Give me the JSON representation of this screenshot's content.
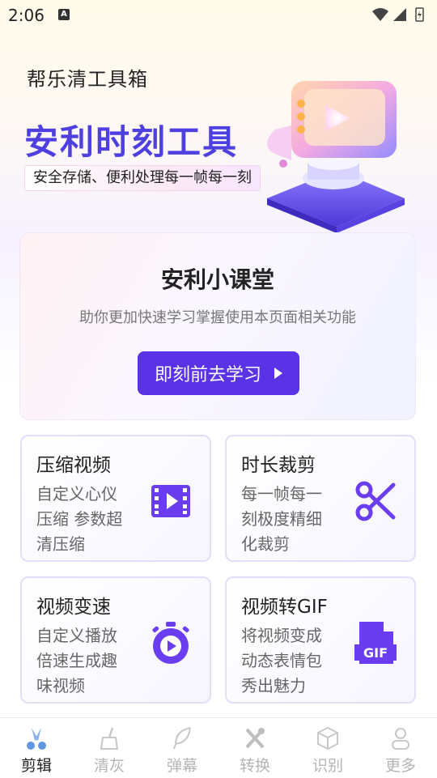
{
  "status": {
    "time": "2:06",
    "a_icon": "A"
  },
  "hero": {
    "subtitle": "帮乐清工具箱",
    "title": "安利时刻工具",
    "tagline": "安全存储、便利处理每一帧每一刻",
    "art_icon": "video-player-illustration-icon"
  },
  "lesson": {
    "title": "安利小课堂",
    "description": "助你更加快速学习掌握使用本页面相关功能",
    "button_label": "即刻前去学习"
  },
  "cards": [
    {
      "title": "压缩视频",
      "desc": "自定义心仪压缩 参数超清压缩",
      "icon": "video-film-icon"
    },
    {
      "title": "时长裁剪",
      "desc": "每一帧每一刻极度精细化裁剪",
      "icon": "scissors-icon"
    },
    {
      "title": "视频变速",
      "desc": "自定义播放倍速生成趣味视频",
      "icon": "stopwatch-icon"
    },
    {
      "title": "视频转GIF",
      "desc": "将视频变成动态表情包秀出魅力",
      "icon": "gif-file-icon",
      "icon_text": "GIF"
    }
  ],
  "tabs": [
    {
      "label": "剪辑",
      "icon": "scissors-tab-icon",
      "active": true
    },
    {
      "label": "清灰",
      "icon": "broom-icon",
      "active": false
    },
    {
      "label": "弹幕",
      "icon": "feather-icon",
      "active": false
    },
    {
      "label": "转换",
      "icon": "tools-icon",
      "active": false
    },
    {
      "label": "识别",
      "icon": "cube-icon",
      "active": false
    },
    {
      "label": "更多",
      "icon": "person-icon",
      "active": false
    }
  ],
  "colors": {
    "accent": "#5a33e6",
    "title_blue": "#4d3fe0",
    "tab_inactive": "#b5b5b5"
  }
}
